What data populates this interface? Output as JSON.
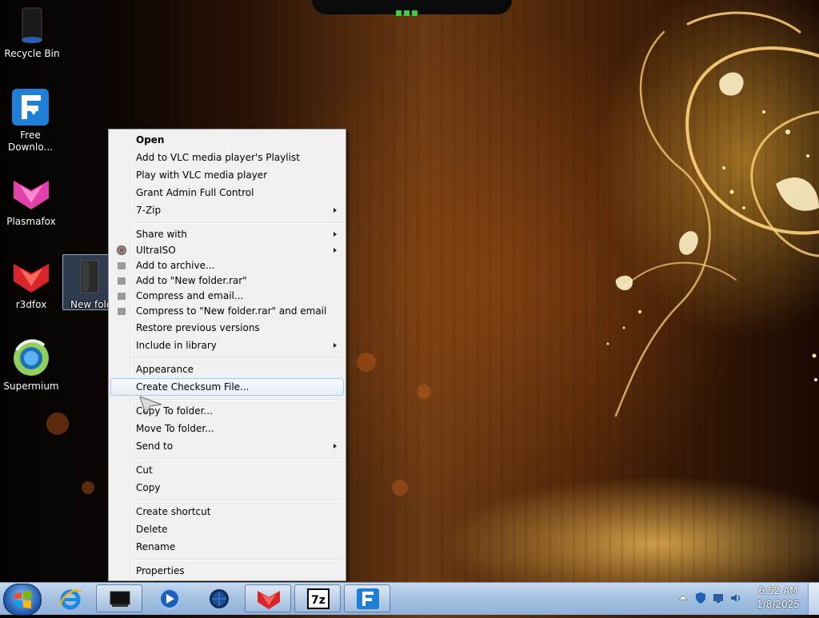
{
  "desktop": {
    "icons": [
      {
        "label": "Recycle Bin"
      },
      {
        "label": "Free Downlo..."
      },
      {
        "label": "Plasmafox"
      },
      {
        "label": "r3dfox"
      },
      {
        "label": "New fold"
      },
      {
        "label": "Supermium"
      }
    ]
  },
  "context_menu": {
    "items": [
      {
        "label": "Open"
      },
      {
        "label": "Add to VLC media player's Playlist"
      },
      {
        "label": "Play with VLC media player"
      },
      {
        "label": "Grant Admin Full Control"
      },
      {
        "label": "7-Zip"
      },
      {
        "label": "Share with"
      },
      {
        "label": "UltraISO"
      },
      {
        "label": "Add to archive..."
      },
      {
        "label": "Add to \"New folder.rar\""
      },
      {
        "label": "Compress and email..."
      },
      {
        "label": "Compress to \"New folder.rar\" and email"
      },
      {
        "label": "Restore previous versions"
      },
      {
        "label": "Include in library"
      },
      {
        "label": "Appearance"
      },
      {
        "label": "Create Checksum File..."
      },
      {
        "label": "Copy To folder..."
      },
      {
        "label": "Move To folder..."
      },
      {
        "label": "Send to"
      },
      {
        "label": "Cut"
      },
      {
        "label": "Copy"
      },
      {
        "label": "Create shortcut"
      },
      {
        "label": "Delete"
      },
      {
        "label": "Rename"
      },
      {
        "label": "Properties"
      }
    ],
    "highlighted_item": "Create Checksum File..."
  },
  "taskbar": {
    "pinned": [
      {
        "icon": "internet-explorer-icon"
      },
      {
        "icon": "window-icon"
      },
      {
        "icon": "media-player-icon"
      },
      {
        "icon": "globe-browser-icon"
      },
      {
        "icon": "r3dfox-icon"
      },
      {
        "icon": "7zip-icon"
      },
      {
        "icon": "free-download-manager-icon"
      }
    ],
    "clock": {
      "time": "6:52 AM",
      "date": "1/8/2025"
    }
  },
  "colors": {
    "menu_bg": "#f0f0f0",
    "menu_highlight_border": "#a8c8ec",
    "taskbar": "#a6c2e2",
    "wallpaper_accent": "#f5b84a"
  }
}
